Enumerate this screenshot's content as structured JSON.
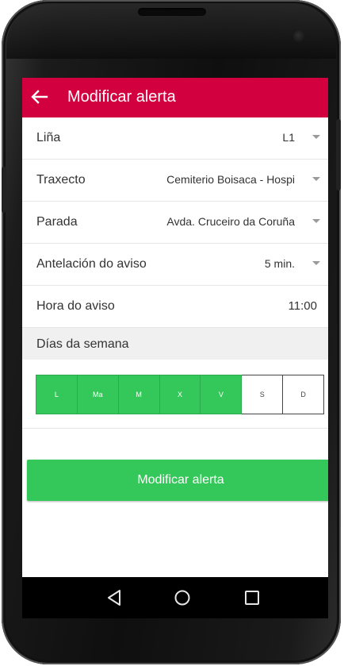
{
  "appbar": {
    "title": "Modificar alerta",
    "back_icon": "arrow-left-icon"
  },
  "form": {
    "line": {
      "label": "Liña",
      "value": "L1"
    },
    "route": {
      "label": "Traxecto",
      "value": "Cemiterio Boisaca - Hospi"
    },
    "stop": {
      "label": "Parada",
      "value": "Avda. Cruceiro da Coruña"
    },
    "advance": {
      "label": "Antelación do aviso",
      "value": "5 min."
    },
    "time": {
      "label": "Hora do aviso",
      "value": "11:00"
    }
  },
  "days": {
    "header": "Días da semana",
    "items": [
      {
        "label": "L",
        "selected": true
      },
      {
        "label": "Ma",
        "selected": true
      },
      {
        "label": "M",
        "selected": true
      },
      {
        "label": "X",
        "selected": true
      },
      {
        "label": "V",
        "selected": true
      },
      {
        "label": "S",
        "selected": false
      },
      {
        "label": "D",
        "selected": false
      }
    ]
  },
  "submit_button": {
    "label": "Modificar alerta"
  },
  "colors": {
    "appbar": "#d2003e",
    "accent_green": "#34c759"
  },
  "android_nav": {
    "icons": [
      "back-triangle-icon",
      "home-circle-icon",
      "recents-square-icon"
    ]
  }
}
